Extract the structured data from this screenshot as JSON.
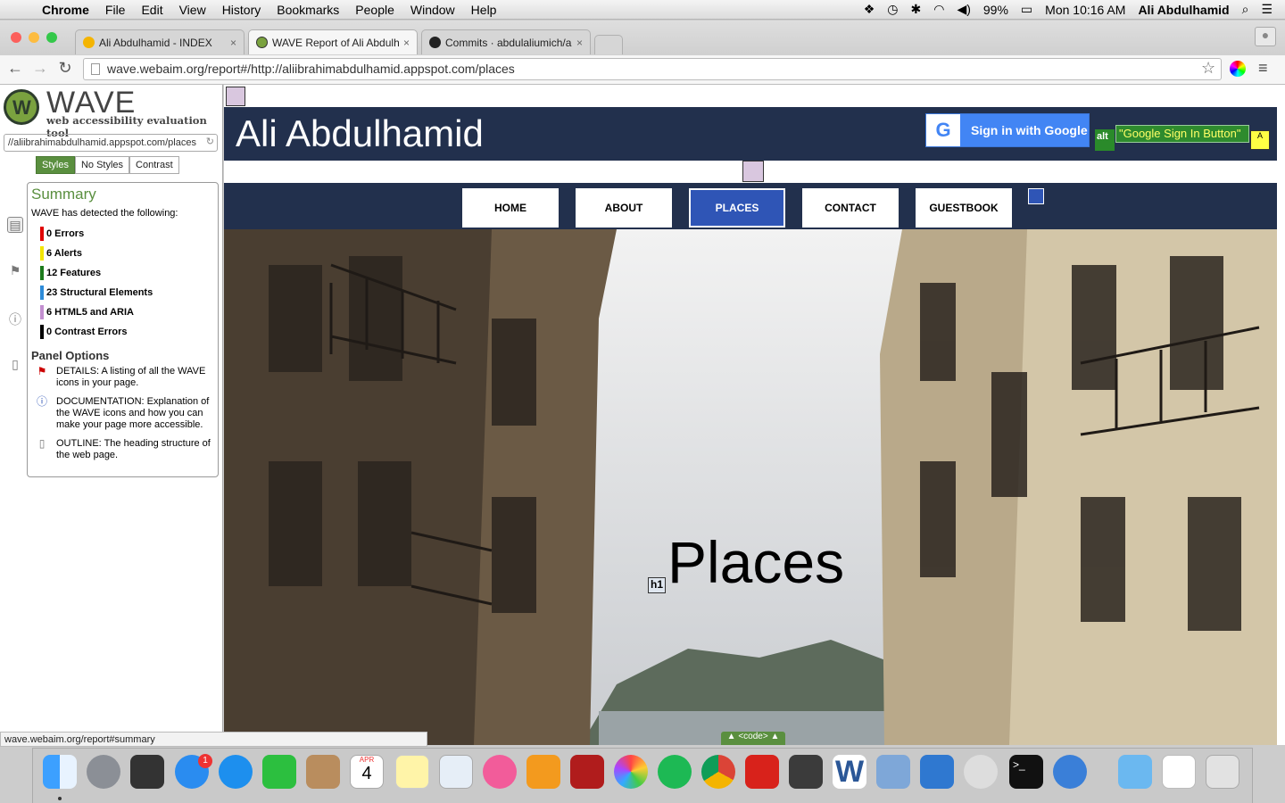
{
  "menubar": {
    "apple": "",
    "app": "Chrome",
    "items": [
      "File",
      "Edit",
      "View",
      "History",
      "Bookmarks",
      "People",
      "Window",
      "Help"
    ],
    "battery": "99%",
    "clock": "Mon 10:16 AM",
    "user": "Ali Abdulhamid"
  },
  "tabs": [
    {
      "label": "Ali Abdulhamid - INDEX",
      "close": "×"
    },
    {
      "label": "WAVE Report of Ali Abdulh",
      "close": "×"
    },
    {
      "label": "Commits · abdulaliumich/a",
      "close": "×"
    }
  ],
  "toolbar": {
    "url": "wave.webaim.org/report#/http://aliibrahimabdulhamid.appspot.com/places"
  },
  "wave": {
    "logo_word": "WAVE",
    "logo_tag": "web accessibility evaluation tool",
    "url_field": "//aliibrahimabdulhamid.appspot.com/places",
    "style_buttons": [
      "Styles",
      "No Styles",
      "Contrast"
    ],
    "summary_title": "Summary",
    "summary_intro": "WAVE has detected the following:",
    "summary_rows": [
      {
        "label": "0 Errors",
        "color": "#e00000"
      },
      {
        "label": "6 Alerts",
        "color": "#f2e500"
      },
      {
        "label": "12 Features",
        "color": "#1c7a1c"
      },
      {
        "label": "23 Structural Elements",
        "color": "#2d8bd8"
      },
      {
        "label": "6 HTML5 and ARIA",
        "color": "#c28fd0"
      },
      {
        "label": "0 Contrast Errors",
        "color": "#000000"
      }
    ],
    "panel_options_title": "Panel Options",
    "panel_options": [
      {
        "text": "DETAILS: A listing of all the WAVE icons in your page.",
        "icon": "flag-icon"
      },
      {
        "text": "DOCUMENTATION: Explanation of the WAVE icons and how you can make your page more accessible.",
        "icon": "info-icon"
      },
      {
        "text": "OUTLINE: The heading structure of the web page.",
        "icon": "document-icon"
      }
    ]
  },
  "site": {
    "title": "Ali Abdulhamid",
    "google_button": "Sign in with Google",
    "google_letter": "G",
    "alt_badge": "alt",
    "alt_text": "\"Google Sign In Button\"",
    "nav": [
      "HOME",
      "ABOUT",
      "PLACES",
      "CONTACT",
      "GUESTBOOK"
    ],
    "active_nav": "PLACES",
    "hero_title": "Places",
    "h1_tag": "h1",
    "code_tab": "▲ <code> ▲",
    "header_color": "#22304d",
    "active_color": "#2f55b6"
  },
  "status_bar": "wave.webaim.org/report#summary",
  "dock": {
    "calendar_month": "APR",
    "calendar_day": "4",
    "appstore_badge": "1"
  }
}
